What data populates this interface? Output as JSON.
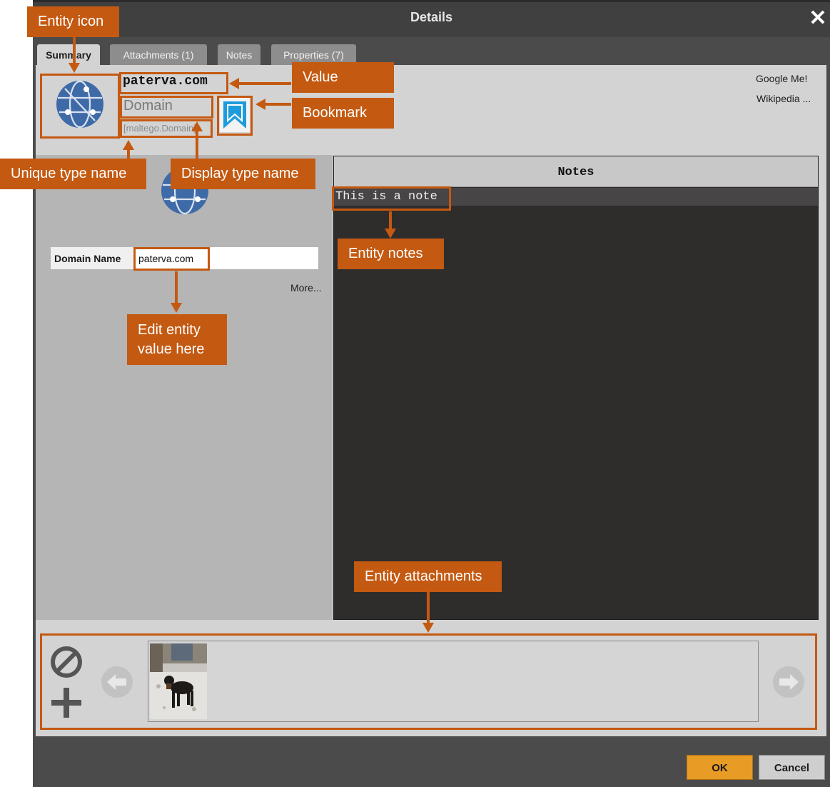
{
  "dialog": {
    "title": "Details",
    "close_glyph": "✕"
  },
  "tabs": [
    {
      "label": "Summary",
      "active": true
    },
    {
      "label": "Attachments (1)",
      "active": false
    },
    {
      "label": "Notes",
      "active": false
    },
    {
      "label": "Properties (7)",
      "active": false
    }
  ],
  "entity": {
    "icon": "globe-network-icon",
    "value": "paterva.com",
    "display_type": "Domain",
    "unique_type": "[maltego.Domain]",
    "bookmark_color": "#1e9bdc"
  },
  "links": {
    "google": "Google Me!",
    "wikipedia": "Wikipedia ..."
  },
  "properties": {
    "label": "Domain Name",
    "value": "paterva.com",
    "more": "More..."
  },
  "notes": {
    "header": "Notes",
    "text": "This is a note"
  },
  "attachments": {
    "count": 1,
    "thumbnail": "dog-photo"
  },
  "buttons": {
    "ok": "OK",
    "cancel": "Cancel"
  },
  "annotations": {
    "entity_icon": "Entity icon",
    "value": "Value",
    "bookmark": "Bookmark",
    "unique_type_name": "Unique type name",
    "display_type_name": "Display type name",
    "entity_notes": "Entity notes",
    "edit_value_line1": "Edit entity",
    "edit_value_line2": "value here",
    "entity_attachments": "Entity attachments",
    "color": "#c45911"
  }
}
